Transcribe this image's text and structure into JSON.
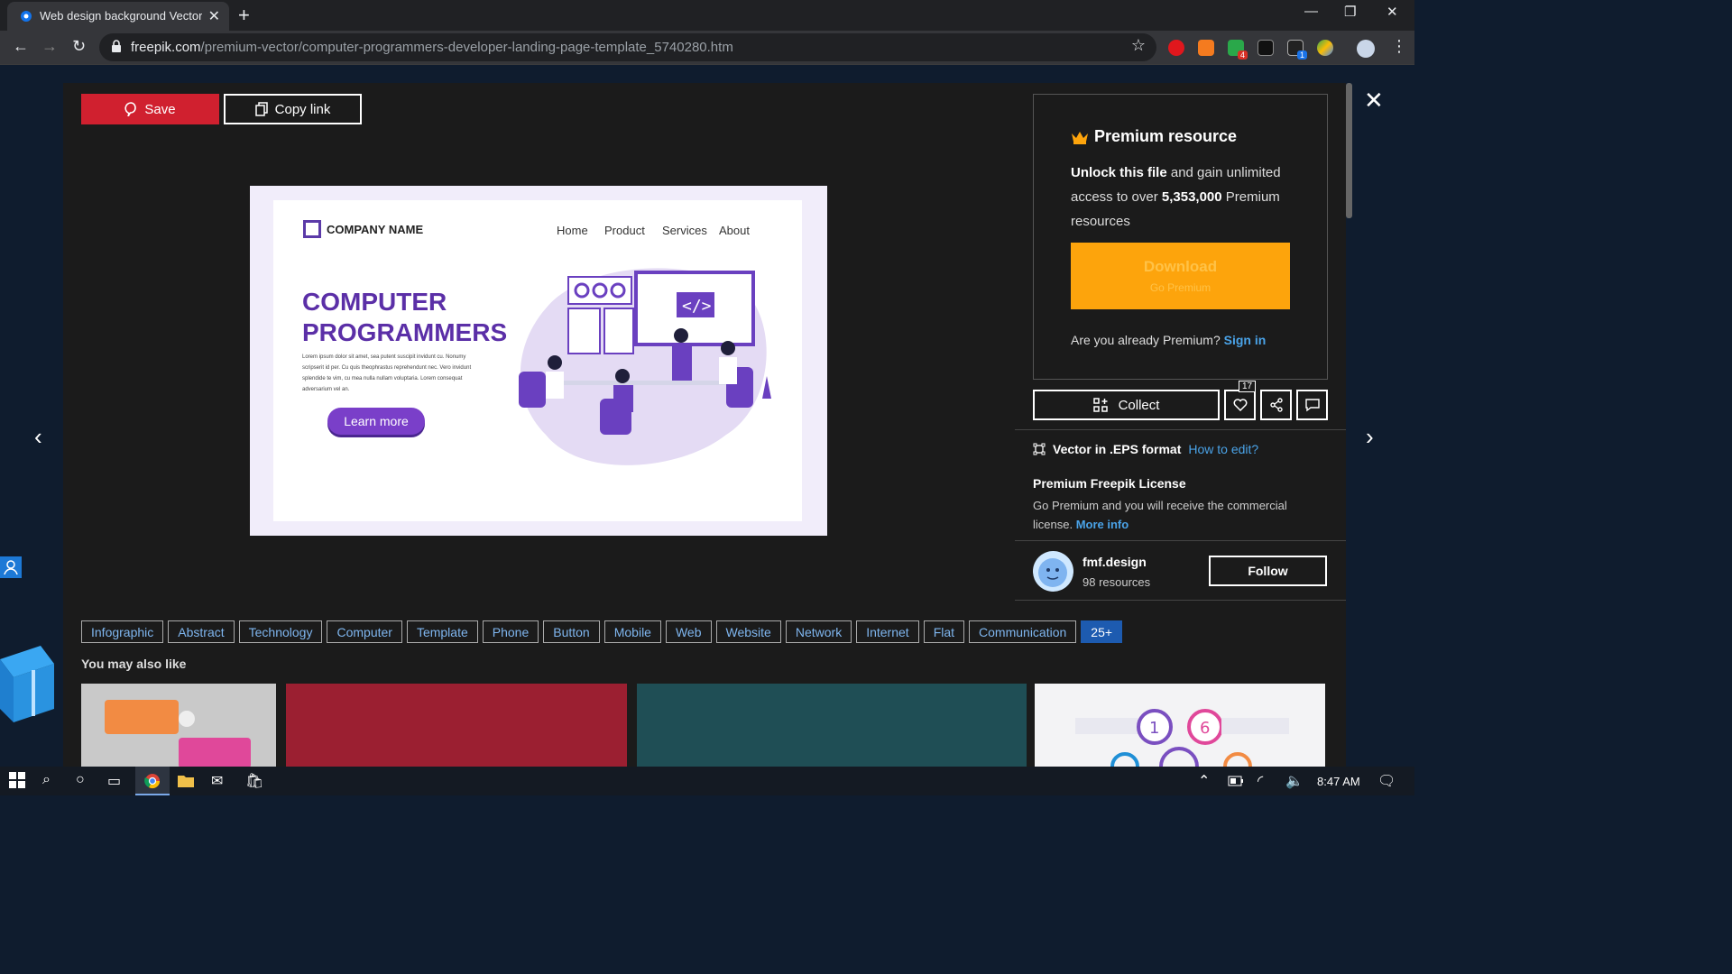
{
  "browser": {
    "tab_title": "Web design background Vector |",
    "url_host": "freepik.com",
    "url_path": "/premium-vector/computer-programmers-developer-landing-page-template_5740280.htm",
    "ext_badges": [
      "4",
      "1"
    ]
  },
  "toolbar": {
    "save_label": "Save",
    "copy_label": "Copy link"
  },
  "preview": {
    "company": "COMPANY NAME",
    "nav": [
      "Home",
      "Product",
      "Services",
      "About"
    ],
    "headline_1": "COMPUTER",
    "headline_2": "PROGRAMMERS",
    "lorem": "Lorem ipsum dolor sit amet, sea putent suscipit invidunt cu. Nonumy scripserit id per. Cu quis theophrastus reprehendunt nec. Vero invidunt splendide te vim, cu mea nulla nullam voluptaria. Lorem consequat adversarium vel an.",
    "cta": "Learn more"
  },
  "premium": {
    "title": "Premium resource",
    "desc_bold": "Unlock this file",
    "desc_rest": " and gain unlimited access to over ",
    "count": "5,353,000",
    "desc_tail": " Premium resources",
    "download": "Download",
    "download_sub": "Go Premium",
    "already": "Are you already Premium?",
    "signin": "Sign in"
  },
  "actions": {
    "collect": "Collect",
    "likes": "17"
  },
  "format": {
    "label": "Vector in .EPS format",
    "howto": "How to edit?"
  },
  "license": {
    "title": "Premium Freepik License",
    "desc": "Go Premium and you will receive the commercial license.",
    "more": "More info"
  },
  "author": {
    "name": "fmf.design",
    "resources": "98 resources",
    "follow": "Follow"
  },
  "tags": [
    "Infographic",
    "Abstract",
    "Technology",
    "Computer",
    "Template",
    "Phone",
    "Button",
    "Mobile",
    "Web",
    "Website",
    "Network",
    "Internet",
    "Flat",
    "Communication"
  ],
  "tags_more": "25+",
  "also_title": "You may also like",
  "colors": {
    "save": "#d0202f",
    "download": "#fda40c",
    "link": "#4aa3e8",
    "purple": "#5b2fa7",
    "thumb_red": "#9b1f31",
    "thumb_teal": "#1f4e55"
  },
  "taskbar": {
    "time": "8:47 AM"
  }
}
